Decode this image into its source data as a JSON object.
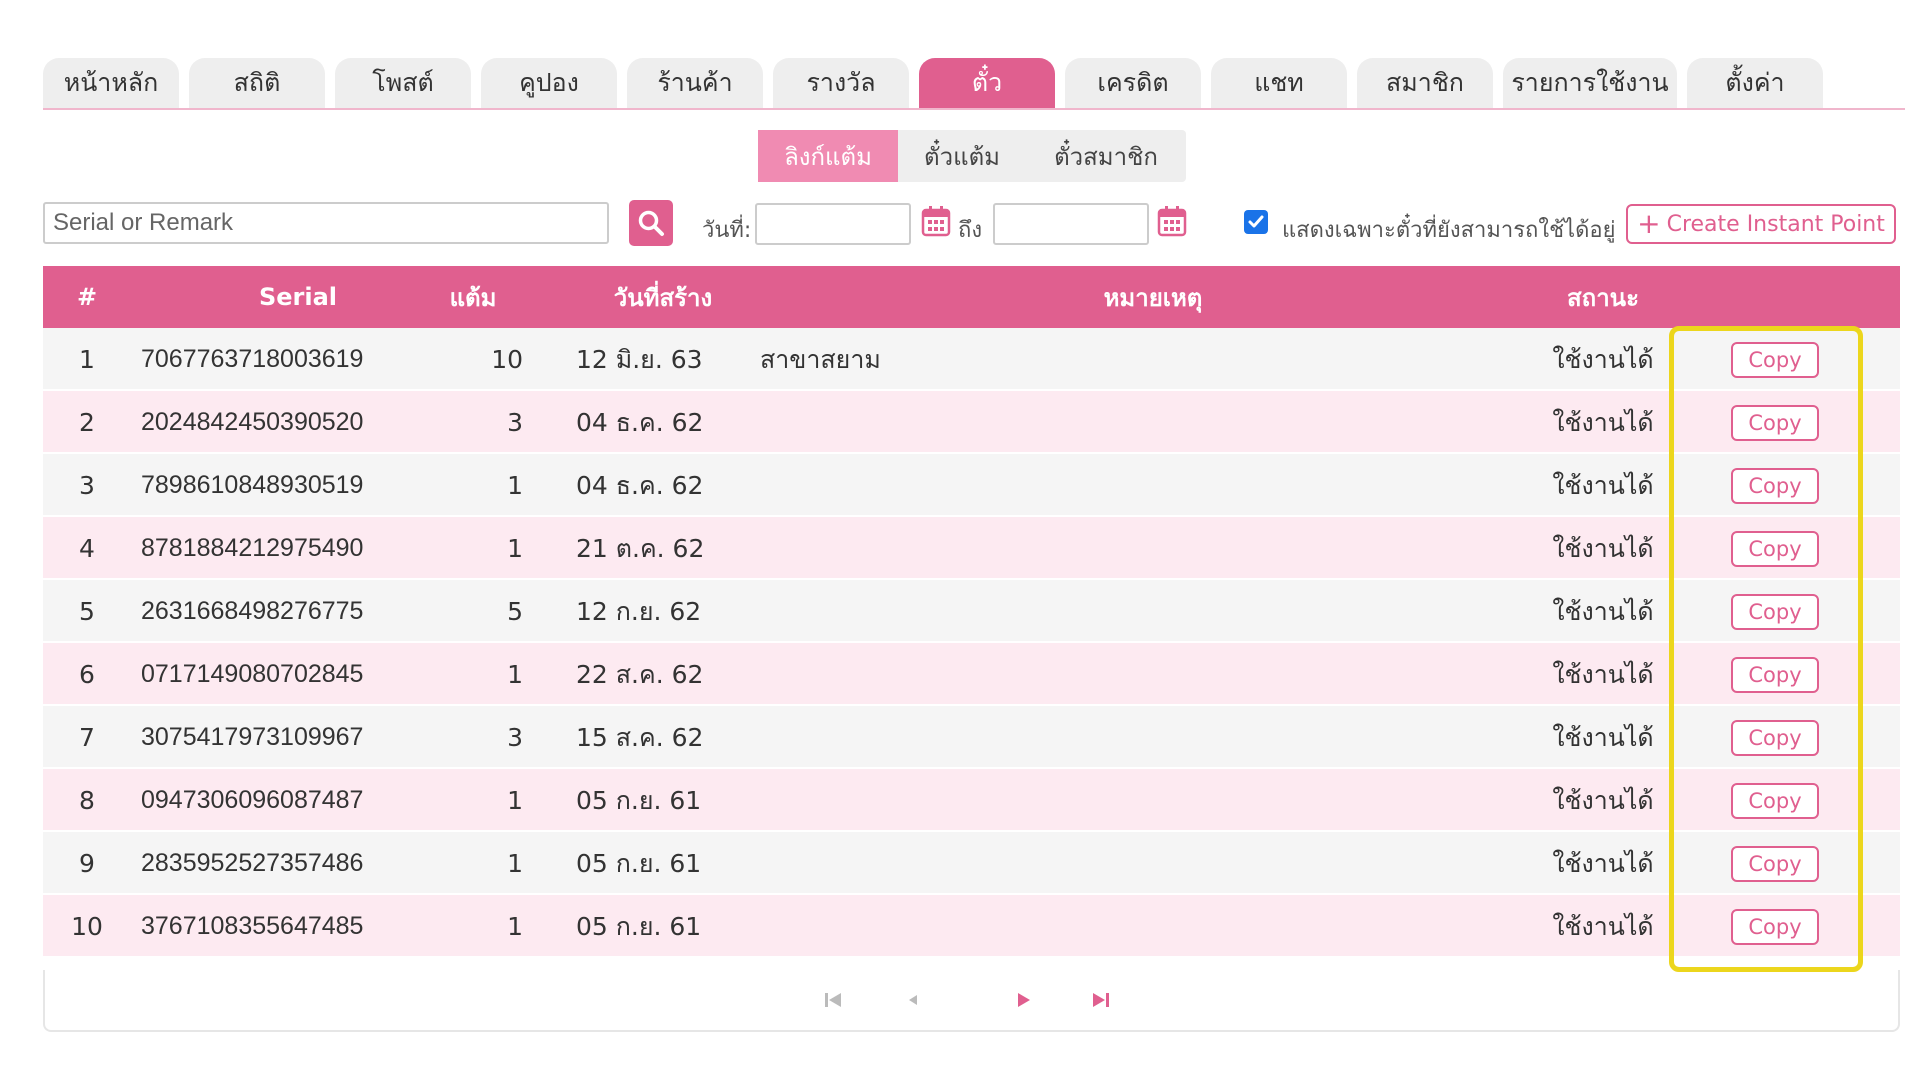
{
  "nav": {
    "tabs": [
      {
        "label": "หน้าหลัก",
        "active": false
      },
      {
        "label": "สถิติ",
        "active": false
      },
      {
        "label": "โพสต์",
        "active": false
      },
      {
        "label": "คูปอง",
        "active": false
      },
      {
        "label": "ร้านค้า",
        "active": false
      },
      {
        "label": "รางวัล",
        "active": false
      },
      {
        "label": "ตั๋ว",
        "active": true
      },
      {
        "label": "เครดิต",
        "active": false
      },
      {
        "label": "แชท",
        "active": false
      },
      {
        "label": "สมาชิก",
        "active": false
      },
      {
        "label": "รายการใช้งาน",
        "active": false
      },
      {
        "label": "ตั้งค่า",
        "active": false
      }
    ]
  },
  "subtabs": [
    {
      "label": "ลิงก์แต้ม",
      "active": true
    },
    {
      "label": "ตั๋วแต้ม",
      "active": false
    },
    {
      "label": "ตั๋วสมาชิก",
      "active": false
    }
  ],
  "filters": {
    "search_placeholder": "Serial or Remark",
    "date_label": "วันที่:",
    "to_label": "ถึง",
    "date_from_value": "",
    "date_to_value": "",
    "only_available_label": "แสดงเฉพาะตั๋วที่ยังสามารถใช้ได้อยู่",
    "only_available_checked": true,
    "create_button": "Create Instant Point"
  },
  "table": {
    "headers": {
      "index": "#",
      "serial": "Serial",
      "point": "แต้ม",
      "created": "วันที่สร้าง",
      "remark": "หมายเหตุ",
      "status": "สถานะ"
    },
    "copy_label": "Copy",
    "rows": [
      {
        "index": "1",
        "serial": "7067763718003619",
        "point": "10",
        "created": "12 มิ.ย. 63",
        "remark": "สาขาสยาม",
        "status": "ใช้งานได้"
      },
      {
        "index": "2",
        "serial": "2024842450390520",
        "point": "3",
        "created": "04 ธ.ค. 62",
        "remark": "",
        "status": "ใช้งานได้"
      },
      {
        "index": "3",
        "serial": "7898610848930519",
        "point": "1",
        "created": "04 ธ.ค. 62",
        "remark": "",
        "status": "ใช้งานได้"
      },
      {
        "index": "4",
        "serial": "8781884212975490",
        "point": "1",
        "created": "21 ต.ค. 62",
        "remark": "",
        "status": "ใช้งานได้"
      },
      {
        "index": "5",
        "serial": "2631668498276775",
        "point": "5",
        "created": "12 ก.ย. 62",
        "remark": "",
        "status": "ใช้งานได้"
      },
      {
        "index": "6",
        "serial": "0717149080702845",
        "point": "1",
        "created": "22 ส.ค. 62",
        "remark": "",
        "status": "ใช้งานได้"
      },
      {
        "index": "7",
        "serial": "3075417973109967",
        "point": "3",
        "created": "15 ส.ค. 62",
        "remark": "",
        "status": "ใช้งานได้"
      },
      {
        "index": "8",
        "serial": "0947306096087487",
        "point": "1",
        "created": "05 ก.ย. 61",
        "remark": "",
        "status": "ใช้งานได้"
      },
      {
        "index": "9",
        "serial": "2835952527357486",
        "point": "1",
        "created": "05 ก.ย. 61",
        "remark": "",
        "status": "ใช้งานได้"
      },
      {
        "index": "10",
        "serial": "3767108355647485",
        "point": "1",
        "created": "05 ก.ย. 61",
        "remark": "",
        "status": "ใช้งานได้"
      }
    ]
  },
  "pager": {
    "icons": [
      "first-page-icon",
      "prev-page-icon",
      "next-page-icon",
      "last-page-icon"
    ]
  },
  "colors": {
    "accent": "#e05f8f",
    "highlight": "#ecd61c",
    "row_alt": "#fdeaf1"
  }
}
